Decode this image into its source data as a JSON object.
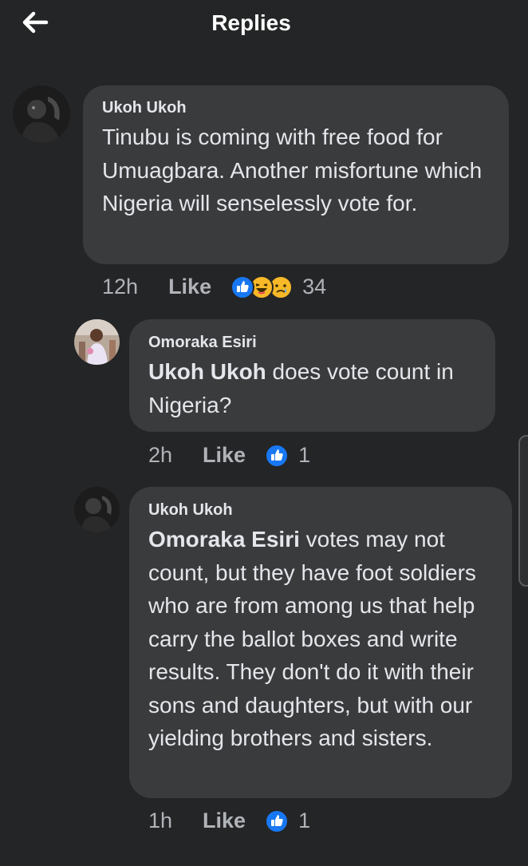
{
  "header": {
    "title": "Replies",
    "back_icon": "arrow-left-icon"
  },
  "colors": {
    "background": "#242526",
    "bubble": "#3a3b3c",
    "like_blue": "#1877f2",
    "haha_yellow": "#f7b928"
  },
  "comments": [
    {
      "author": "Ukoh Ukoh",
      "mention": "",
      "text": "Tinubu is coming with free food for Umuagbara. Another misfortune which Nigeria will senselessly vote for.",
      "time": "12h",
      "like_label": "Like",
      "reactions": [
        "like-icon",
        "haha-icon",
        "sad-icon"
      ],
      "reaction_count": "34"
    },
    {
      "author": "Omoraka Esiri",
      "mention": "Ukoh Ukoh",
      "text": " does vote count in Nigeria?",
      "time": "2h",
      "like_label": "Like",
      "reactions": [
        "like-icon"
      ],
      "reaction_count": "1"
    },
    {
      "author": "Ukoh Ukoh",
      "mention": "Omoraka Esiri",
      "text": " votes may not count, but they have foot soldiers who are from among us that help carry the ballot boxes and write results. They don't do it with their sons and daughters, but with our yielding brothers and sisters.",
      "time": "1h",
      "like_label": "Like",
      "reactions": [
        "like-icon"
      ],
      "reaction_count": "1"
    }
  ]
}
